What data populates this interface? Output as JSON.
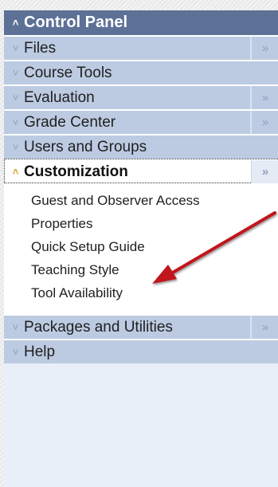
{
  "control_panel": {
    "title": "Control Panel",
    "items": [
      {
        "label": "Files",
        "expandable": true
      },
      {
        "label": "Course Tools",
        "expandable": false
      },
      {
        "label": "Evaluation",
        "expandable": true
      },
      {
        "label": "Grade Center",
        "expandable": true
      },
      {
        "label": "Users and Groups",
        "expandable": false
      },
      {
        "label": "Customization",
        "expandable": true,
        "expanded": true
      },
      {
        "label": "Packages and Utilities",
        "expandable": true
      },
      {
        "label": "Help",
        "expandable": false
      }
    ],
    "customization_submenu": [
      "Guest and Observer Access",
      "Properties",
      "Quick Setup Guide",
      "Teaching Style",
      "Tool Availability"
    ]
  },
  "icons": {
    "collapse": "chevron-up-icon",
    "expand": "chevron-down-icon",
    "flyout": "double-chevron-right-icon",
    "annotation": "red-arrow"
  },
  "colors": {
    "header": "#5d7096",
    "item": "#bccbe2",
    "active_chevron": "#d6a533",
    "arrow": "#c0181c"
  }
}
